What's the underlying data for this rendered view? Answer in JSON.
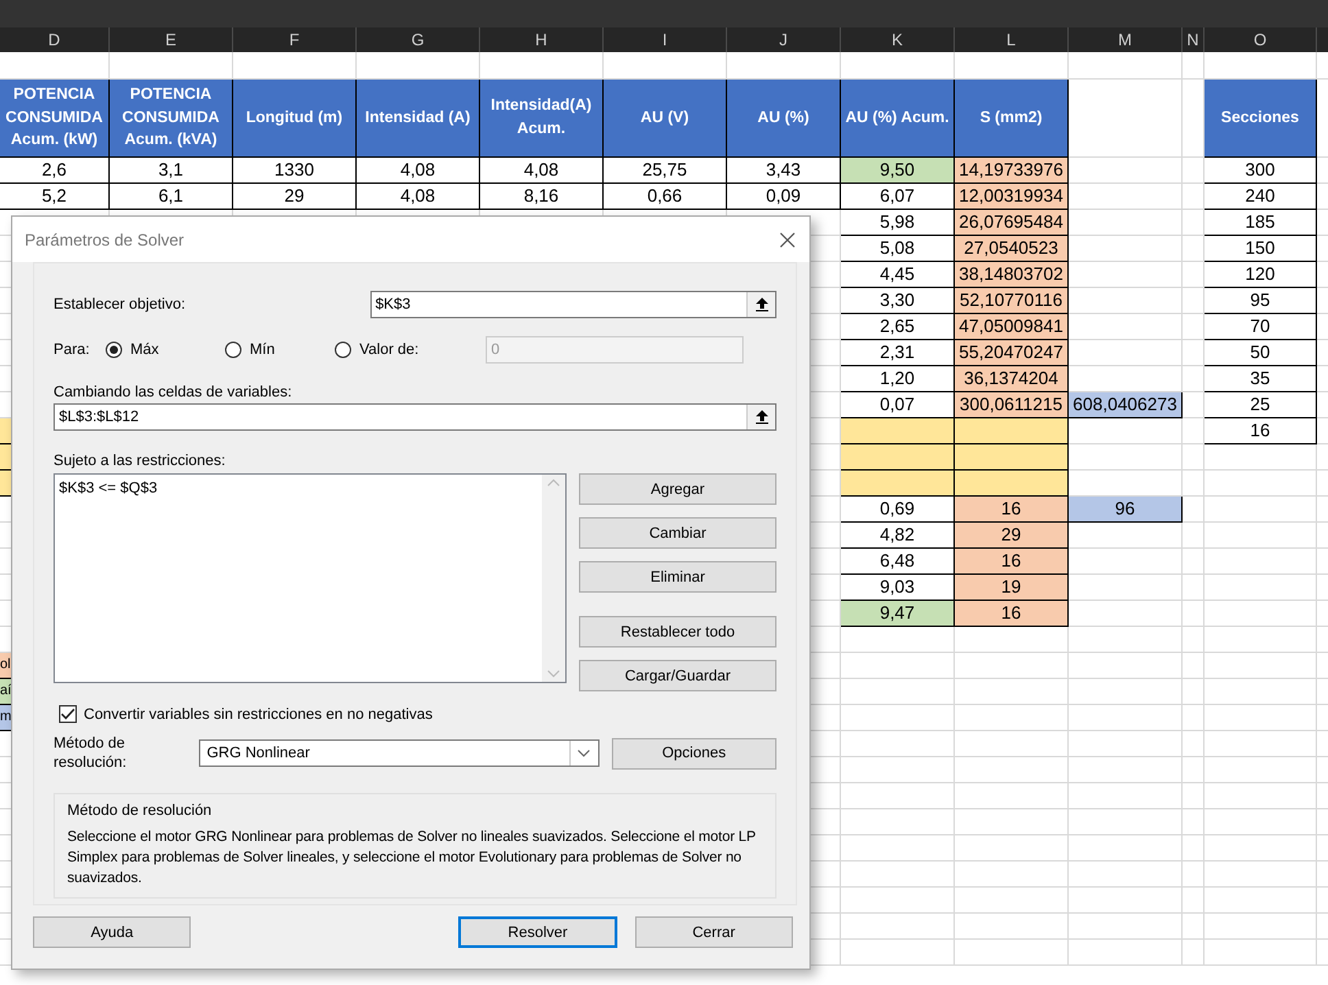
{
  "sheet": {
    "column_headers": [
      "D",
      "E",
      "F",
      "G",
      "H",
      "I",
      "J",
      "K",
      "L",
      "M",
      "N",
      "O"
    ],
    "rows": [
      {
        "kind": "plain",
        "cells": []
      },
      {
        "kind": "header",
        "cells": [
          {
            "text": "POTENCIA CONSUMIDA Acum. (kW)"
          },
          {
            "text": "POTENCIA CONSUMIDA Acum. (kVA)"
          },
          {
            "text": "Longitud (m)"
          },
          {
            "text": "Intensidad (A)"
          },
          {
            "text": "Intensidad(A) Acum."
          },
          {
            "text": "AU (V)"
          },
          {
            "text": "AU (%)"
          },
          {
            "text": "AU (%) Acum."
          },
          {
            "text": "S (mm2)"
          },
          {},
          {},
          {
            "text": "Secciones"
          }
        ]
      },
      {
        "kind": "plain",
        "cells": [
          {
            "text": "2,6"
          },
          {
            "text": "3,1"
          },
          {
            "text": "1330"
          },
          {
            "text": "4,08"
          },
          {
            "text": "4,08"
          },
          {
            "text": "25,75"
          },
          {
            "text": "3,43"
          },
          {
            "text": "9,50",
            "color": "#c6e0b4"
          },
          {
            "text": "14,19733976",
            "color": "#f8cbad"
          },
          {},
          {},
          {
            "text": "300"
          }
        ]
      },
      {
        "kind": "plain",
        "cells": [
          {
            "text": "5,2"
          },
          {
            "text": "6,1"
          },
          {
            "text": "29"
          },
          {
            "text": "4,08"
          },
          {
            "text": "8,16"
          },
          {
            "text": "0,66"
          },
          {
            "text": "0,09"
          },
          {
            "text": "6,07"
          },
          {
            "text": "12,00319934",
            "color": "#f8cbad"
          },
          {},
          {},
          {
            "text": "240"
          }
        ]
      },
      {
        "kind": "plain",
        "cells": [
          {},
          {},
          {},
          {},
          {},
          {},
          {},
          {
            "text": "5,98"
          },
          {
            "text": "26,07695484",
            "color": "#f8cbad"
          },
          {},
          {},
          {
            "text": "185"
          }
        ]
      },
      {
        "kind": "plain",
        "cells": [
          {},
          {},
          {},
          {},
          {},
          {},
          {},
          {
            "text": "5,08"
          },
          {
            "text": "27,0540523",
            "color": "#f8cbad"
          },
          {},
          {},
          {
            "text": "150"
          }
        ]
      },
      {
        "kind": "plain",
        "cells": [
          {},
          {},
          {},
          {},
          {},
          {},
          {},
          {
            "text": "4,45"
          },
          {
            "text": "38,14803702",
            "color": "#f8cbad"
          },
          {},
          {},
          {
            "text": "120"
          }
        ]
      },
      {
        "kind": "plain",
        "cells": [
          {},
          {},
          {},
          {},
          {},
          {},
          {},
          {
            "text": "3,30"
          },
          {
            "text": "52,10770116",
            "color": "#f8cbad"
          },
          {},
          {},
          {
            "text": "95"
          }
        ]
      },
      {
        "kind": "plain",
        "cells": [
          {},
          {},
          {},
          {},
          {},
          {},
          {},
          {
            "text": "2,65"
          },
          {
            "text": "47,05009841",
            "color": "#f8cbad"
          },
          {},
          {},
          {
            "text": "70"
          }
        ]
      },
      {
        "kind": "plain",
        "cells": [
          {},
          {},
          {},
          {},
          {},
          {},
          {},
          {
            "text": "2,31"
          },
          {
            "text": "55,20470247",
            "color": "#f8cbad"
          },
          {},
          {},
          {
            "text": "50"
          }
        ]
      },
      {
        "kind": "plain",
        "cells": [
          {},
          {},
          {},
          {},
          {},
          {},
          {},
          {
            "text": "1,20"
          },
          {
            "text": "36,1374204",
            "color": "#f8cbad"
          },
          {},
          {},
          {
            "text": "35"
          }
        ]
      },
      {
        "kind": "plain",
        "cells": [
          {},
          {},
          {},
          {},
          {},
          {},
          {},
          {
            "text": "0,07"
          },
          {
            "text": "300,0611215",
            "color": "#f8cbad"
          },
          {
            "text": "608,0406273",
            "color": "#b4c6e7"
          },
          {},
          {
            "text": "25"
          }
        ]
      },
      {
        "kind": "plain",
        "cells": [
          {
            "color": "#ffe699"
          },
          {},
          {},
          {},
          {},
          {},
          {},
          {
            "color": "#ffe699"
          },
          {
            "color": "#ffe699"
          },
          {},
          {},
          {
            "text": "16"
          }
        ]
      },
      {
        "kind": "plain",
        "cells": [
          {
            "color": "#ffe699"
          },
          {},
          {},
          {},
          {},
          {},
          {},
          {
            "color": "#ffe699"
          },
          {
            "color": "#ffe699"
          }
        ]
      },
      {
        "kind": "plain",
        "cells": [
          {
            "color": "#ffe699"
          },
          {},
          {},
          {},
          {},
          {},
          {},
          {
            "color": "#ffe699"
          },
          {
            "color": "#ffe699"
          }
        ]
      },
      {
        "kind": "plain",
        "cells": [
          {},
          {},
          {},
          {},
          {},
          {},
          {},
          {
            "text": "0,69"
          },
          {
            "text": "16",
            "color": "#f8cbad"
          },
          {
            "text": "96",
            "color": "#b4c6e7"
          }
        ]
      },
      {
        "kind": "plain",
        "cells": [
          {},
          {},
          {},
          {},
          {},
          {},
          {},
          {
            "text": "4,82"
          },
          {
            "text": "29",
            "color": "#f8cbad"
          }
        ]
      },
      {
        "kind": "plain",
        "cells": [
          {},
          {},
          {},
          {},
          {},
          {},
          {},
          {
            "text": "6,48"
          },
          {
            "text": "16",
            "color": "#f8cbad"
          }
        ]
      },
      {
        "kind": "plain",
        "cells": [
          {},
          {},
          {},
          {},
          {},
          {},
          {},
          {
            "text": "9,03"
          },
          {
            "text": "19",
            "color": "#f8cbad"
          }
        ]
      },
      {
        "kind": "plain",
        "cells": [
          {},
          {},
          {},
          {},
          {},
          {},
          {},
          {
            "text": "9,47",
            "color": "#c6e0b4"
          },
          {
            "text": "16",
            "color": "#f8cbad"
          }
        ]
      },
      {
        "kind": "plain",
        "cells": []
      },
      {
        "kind": "plain",
        "cells": [
          {
            "text": "ol",
            "color": "#f8cbad"
          }
        ]
      },
      {
        "kind": "plain",
        "cells": [
          {
            "text": "aí",
            "color": "#c6e0b4"
          }
        ]
      },
      {
        "kind": "plain",
        "cells": [
          {
            "text": "m",
            "color": "#b4c6e7"
          }
        ]
      }
    ]
  },
  "dialog": {
    "title": "Parámetros de Solver",
    "objective": {
      "label": "Establecer objetivo:",
      "value": "$K$3"
    },
    "para": {
      "label": "Para:",
      "options": [
        {
          "label": "Máx",
          "selected": true
        },
        {
          "label": "Mín",
          "selected": false
        },
        {
          "label": "Valor de:",
          "selected": false
        }
      ],
      "value_field": {
        "value": "0",
        "disabled": true
      }
    },
    "variables": {
      "label": "Cambiando las celdas de variables:",
      "value": "$L$3:$L$12"
    },
    "constraints": {
      "label": "Sujeto a las restricciones:",
      "items": [
        "$K$3 <= $Q$3"
      ]
    },
    "side_buttons": [
      "Agregar",
      "Cambiar",
      "Eliminar",
      "Restablecer todo",
      "Cargar/Guardar"
    ],
    "nonnegative": {
      "label": "Convertir variables sin restricciones en no negativas",
      "checked": true
    },
    "method": {
      "label": "Método de resolución:",
      "value": "GRG Nonlinear",
      "options_button": "Opciones"
    },
    "description": {
      "title": "Método de resolución",
      "text": "Seleccione el motor GRG Nonlinear para problemas de Solver no lineales suavizados. Seleccione el motor LP Simplex para problemas de Solver lineales, y seleccione el motor Evolutionary para problemas de Solver no suavizados."
    },
    "footer_buttons": [
      {
        "label": "Ayuda",
        "default": false
      },
      {
        "label": "Resolver",
        "default": true
      },
      {
        "label": "Cerrar",
        "default": false
      }
    ]
  }
}
